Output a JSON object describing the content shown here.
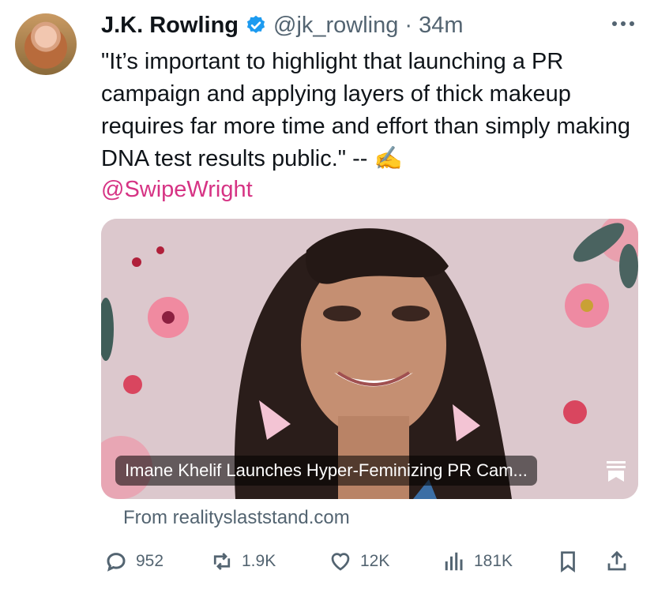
{
  "tweet": {
    "author_name": "J.K. Rowling",
    "handle": "@jk_rowling",
    "separator": "·",
    "time": "34m",
    "text": "\"It’s important to highlight that launching a PR campaign and applying layers of thick makeup requires far more time and effort than simply making DNA test results public.\" -- ✍️",
    "mention": "@SwipeWright"
  },
  "card": {
    "title": "Imane Khelif Launches Hyper-Feminizing PR Cam...",
    "source": "From realityslaststand.com"
  },
  "actions": {
    "replies": "952",
    "retweets": "1.9K",
    "likes": "12K",
    "views": "181K"
  },
  "colors": {
    "verified": "#1d9bf0",
    "mention": "#d63384",
    "muted": "#536471"
  },
  "icons": [
    "verified-badge-icon",
    "more-icon",
    "reply-icon",
    "retweet-icon",
    "like-icon",
    "views-icon",
    "bookmark-icon",
    "share-icon"
  ]
}
